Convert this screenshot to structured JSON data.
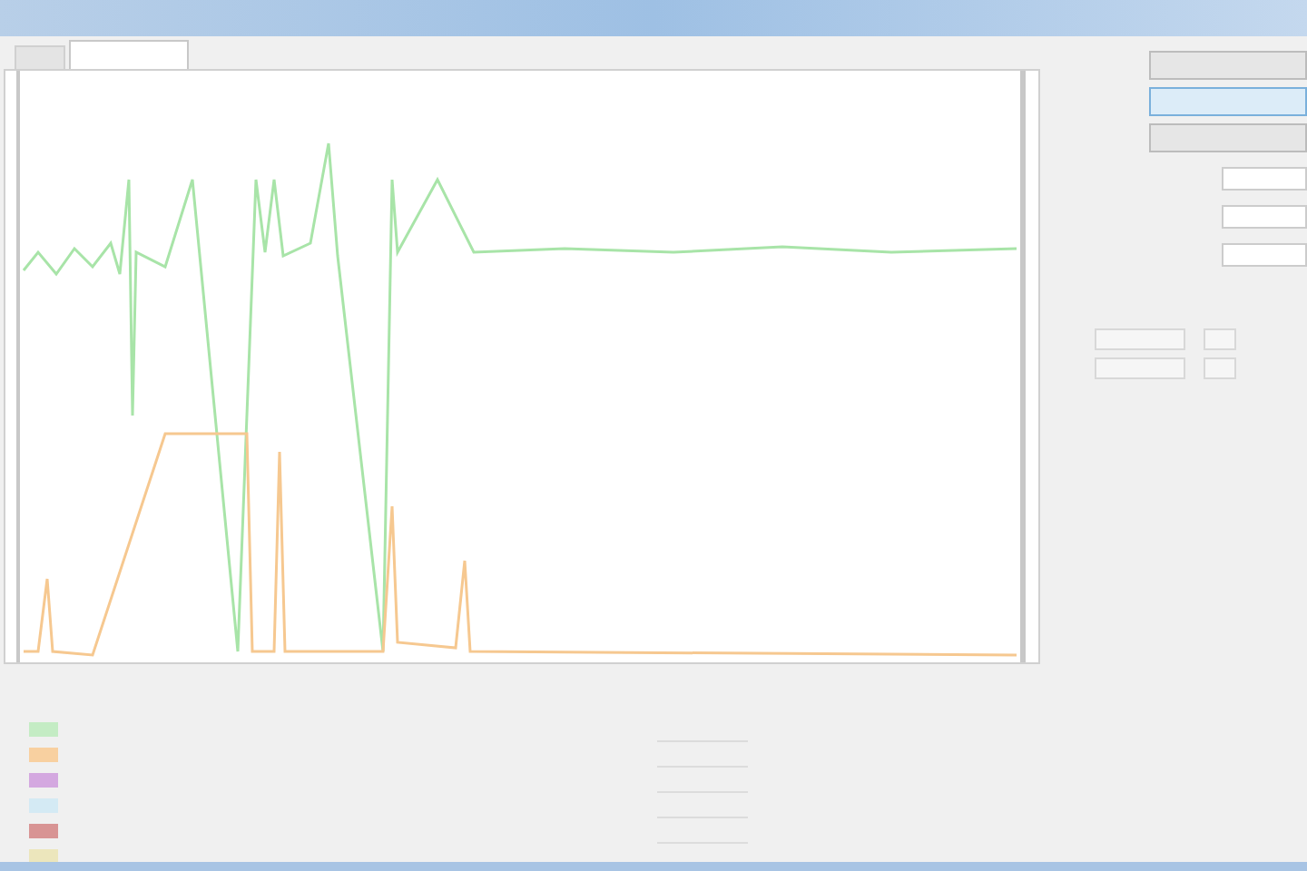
{
  "tabs": [
    {
      "selected": false
    },
    {
      "selected": true
    }
  ],
  "side_buttons": [
    {
      "selected": false
    },
    {
      "selected": true
    },
    {
      "selected": false
    }
  ],
  "chart": {
    "series": [
      {
        "kind": "green",
        "color": "#a8e4a8"
      },
      {
        "kind": "orange",
        "color": "#f6c890"
      }
    ]
  },
  "legend": [
    {
      "color": "#c4ecc4"
    },
    {
      "color": "#f8d0a0"
    },
    {
      "color": "#d4a8e0"
    },
    {
      "color": "#d4eaf4"
    },
    {
      "color": "#d89494"
    },
    {
      "color": "#ece6bc"
    }
  ]
}
